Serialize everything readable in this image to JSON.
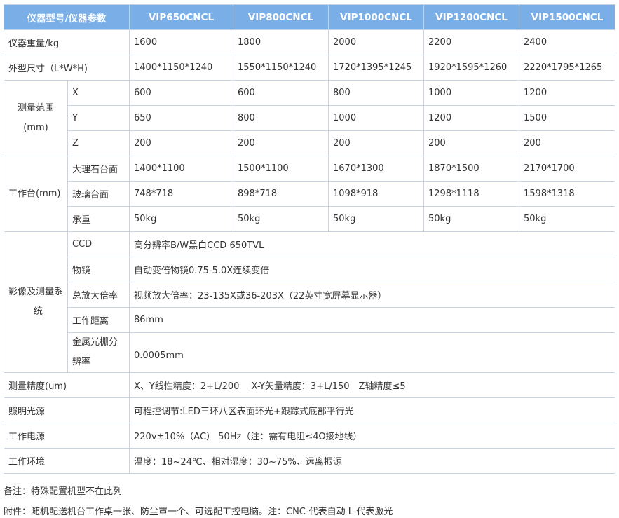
{
  "header": {
    "param": "仪器型号/仪器参数",
    "models": [
      "VIP650CNCL",
      "VIP800CNCL",
      "VIP1000CNCL",
      "VIP1200CNCL",
      "VIP1500CNCL"
    ]
  },
  "weight": {
    "label": "仪器重量/kg",
    "values": [
      "1600",
      "1800",
      "2000",
      "2200",
      "2400"
    ]
  },
  "dimensions": {
    "label": "外型尺寸（L*W*H)",
    "values": [
      "1400*1150*1240",
      "1550*1150*1240",
      "1720*1395*1245",
      "1920*1595*1260",
      "2220*1795*1265"
    ]
  },
  "range": {
    "label_line1": "测量范围",
    "label_line2": "(mm)",
    "rows": [
      {
        "axis": "X",
        "values": [
          "600",
          "600",
          "800",
          "1000",
          "1200"
        ]
      },
      {
        "axis": "Y",
        "values": [
          "650",
          "800",
          "1000",
          "1200",
          "1500"
        ]
      },
      {
        "axis": "Z",
        "values": [
          "200",
          "200",
          "200",
          "200",
          "200"
        ]
      }
    ]
  },
  "worktable": {
    "label": "工作台(mm)",
    "rows": [
      {
        "name": "大理石台面",
        "values": [
          "1400*1100",
          "1500*1100",
          "1670*1300",
          "1870*1500",
          "2170*1700"
        ]
      },
      {
        "name": "玻璃台面",
        "values": [
          "748*718",
          "898*718",
          "1098*918",
          "1298*1118",
          "1598*1318"
        ]
      },
      {
        "name": "承重",
        "values": [
          "50kg",
          "50kg",
          "50kg",
          "50kg",
          "50kg"
        ]
      }
    ]
  },
  "imaging": {
    "label_line1": "影像及测量系",
    "label_line2": "统",
    "rows": [
      {
        "name": "CCD",
        "value": "高分辨率B/W黑白CCD 650TVL"
      },
      {
        "name": "物镜",
        "value": "自动变倍物镜0.75-5.0X连续变倍"
      },
      {
        "name": "总放大倍率",
        "value": "视频放大倍率：23-135X或36-203X（22英寸宽屏幕显示器）"
      },
      {
        "name": "工作距离",
        "value": "86mm"
      }
    ],
    "grating": {
      "name_line1": "金属光栅分",
      "name_line2": "辨率",
      "value": "0.0005mm"
    }
  },
  "accuracy": {
    "label": "测量精度(um)",
    "value": "X、Y线性精度：2+L/200　 X-Y矢量精度：3+L/150　Z轴精度≤5"
  },
  "lighting": {
    "label": "照明光源",
    "value": "可程控调节:LED三环八区表面环光+跟踪式底部平行光"
  },
  "power": {
    "label": "工作电源",
    "value": "220v±10%（AC） 50Hz（注：需有电阻≤4Ω接地线）"
  },
  "environment": {
    "label": "工作环境",
    "value": "温度：18~24℃、相对湿度：30~75%、远离振源"
  },
  "notes": {
    "remark": "备注：特殊配置机型不在此列",
    "accessory": "附件：随机配送机台工作桌一张、防尘罩一个、可选配工控电脑。注：CNC-代表自动 L-代表激光"
  }
}
